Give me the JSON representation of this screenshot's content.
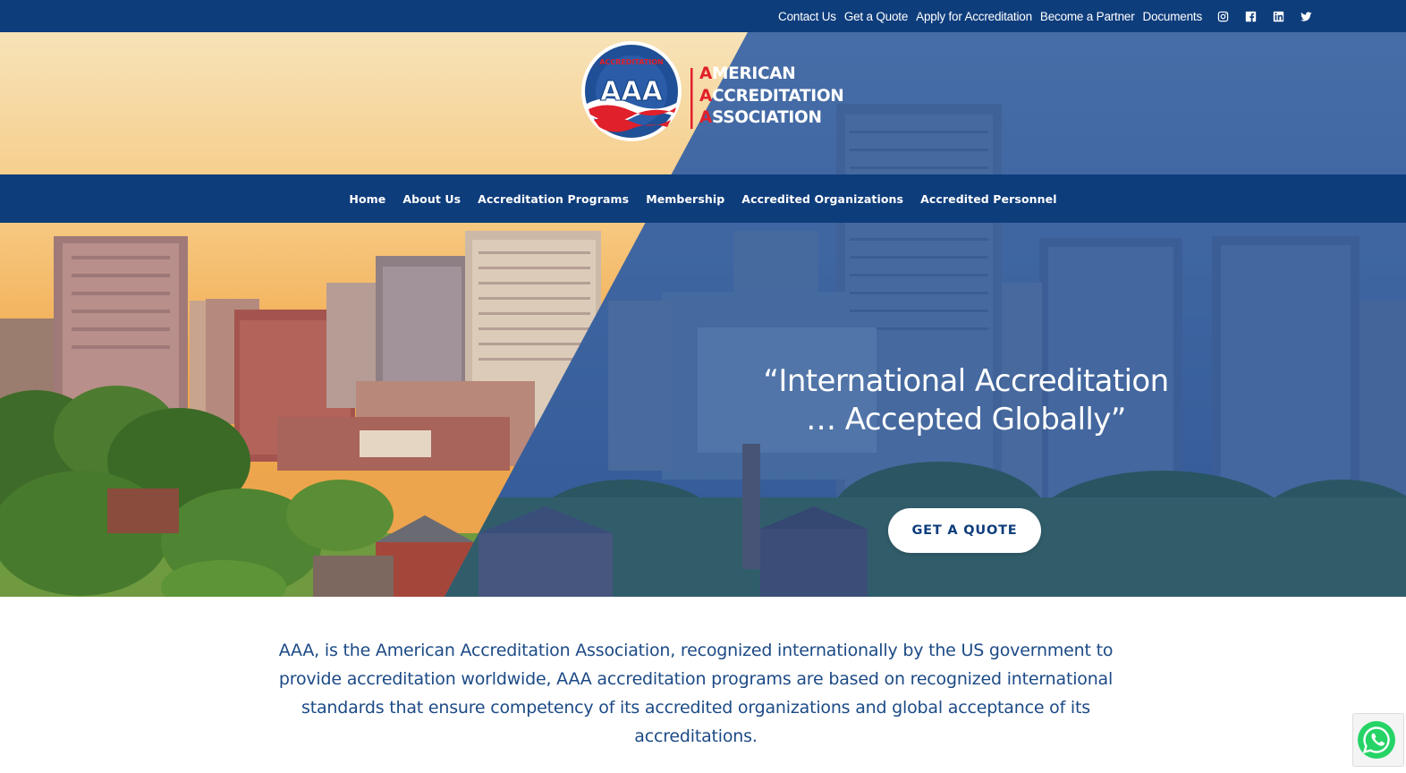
{
  "topbar": {
    "links": [
      "Contact Us",
      "Get a Quote",
      "Apply for Accreditation",
      "Become a Partner",
      "Documents"
    ],
    "social": [
      "instagram-icon",
      "facebook-icon",
      "linkedin-icon",
      "twitter-icon"
    ]
  },
  "logo": {
    "seal_text": "AAA",
    "ring_text": "ACCREDITATION",
    "lines": [
      {
        "cap": "A",
        "rest": "MERICAN"
      },
      {
        "cap": "A",
        "rest": "CCREDITATION"
      },
      {
        "cap": "A",
        "rest": "SSOCIATION"
      }
    ]
  },
  "nav": {
    "items": [
      "Home",
      "About Us",
      "Accreditation Programs",
      "Membership",
      "Accredited Organizations",
      "Accredited Personnel"
    ]
  },
  "hero": {
    "quote_line1": "“International Accreditation",
    "quote_line2": "… Accepted Globally”",
    "cta": "GET A QUOTE"
  },
  "intro": {
    "text": "AAA, is the American Accreditation Association, recognized internationally by the US government to provide accreditation worldwide, AAA accreditation programs are based on recognized international standards that ensure competency of its accredited organizations and global acceptance of its accreditations."
  },
  "colors": {
    "brand_blue": "#0e3d7c",
    "brand_red": "#e0202b",
    "intro_text": "#1c4a86",
    "whatsapp_green": "#25d366"
  }
}
